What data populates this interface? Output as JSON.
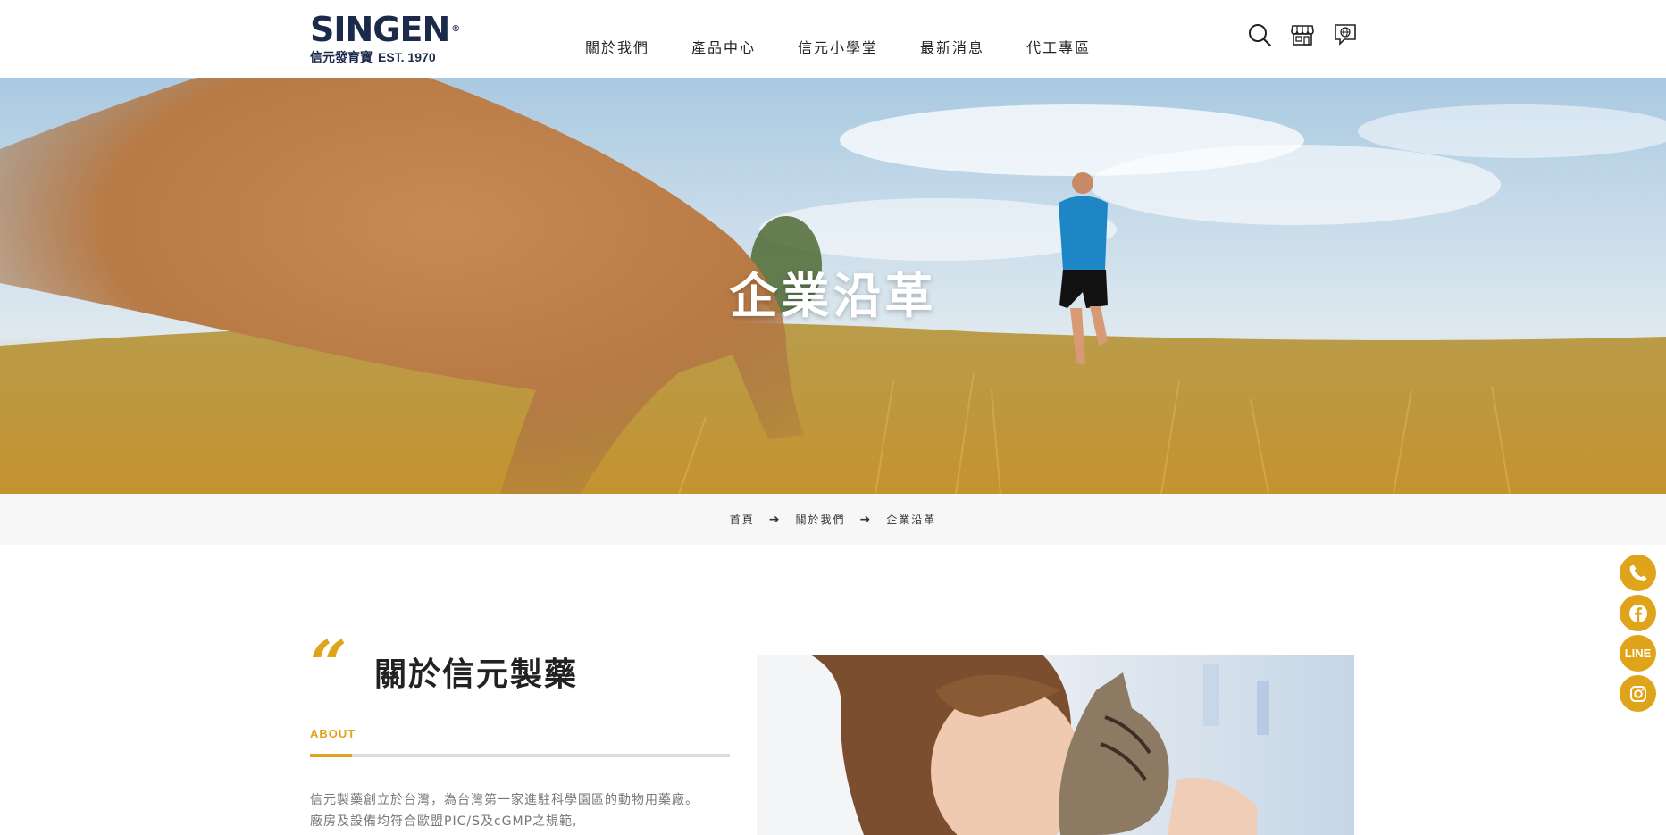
{
  "header": {
    "logo": {
      "wordmark": "SINGEN",
      "registered": "®",
      "chinese": "信元發育寶",
      "est": "EST. 1970"
    },
    "nav": [
      "關於我們",
      "產品中心",
      "信元小學堂",
      "最新消息",
      "代工專區"
    ],
    "tools": [
      "search-icon",
      "store-icon",
      "language-icon"
    ]
  },
  "hero": {
    "title": "企業沿革"
  },
  "breadcrumb": {
    "home": "首頁",
    "parent": "關於我們",
    "current": "企業沿革",
    "separator": "➔"
  },
  "social": {
    "line_label": "LINE",
    "items": [
      "phone-icon",
      "facebook-icon",
      "line-icon",
      "instagram-icon"
    ]
  },
  "about": {
    "quote_mark": "“",
    "heading": "關於信元製藥",
    "label": "ABOUT",
    "progress": 0.1,
    "paragraph": [
      "信元製藥創立於台灣，為台灣第一家進駐科學園區的動物用藥廠。",
      "廠房及設備均符合歐盟PIC/S及cGMP之規範,"
    ]
  },
  "colors": {
    "accent": "#e0a41b",
    "brand_navy": "#1b2a4a",
    "breadcrumb_bg": "#f7f7f7"
  }
}
